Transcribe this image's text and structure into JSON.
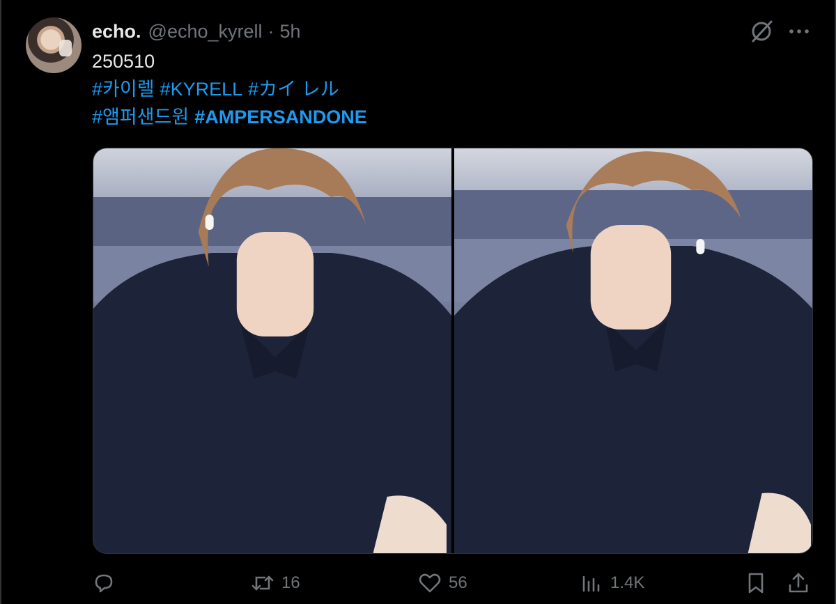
{
  "tweet": {
    "display_name": "echo.",
    "handle": "@echo_kyrell",
    "separator": "·",
    "time": "5h",
    "text_line1": "250510",
    "hashtags_line2": [
      "#카이렐",
      "#KYRELL",
      "#カイ レル"
    ],
    "hashtags_line3": [
      "#앰퍼샌드원",
      "#AMPERSANDONE"
    ]
  },
  "media": {
    "count": 2
  },
  "actions": {
    "replies": "",
    "retweets": "16",
    "likes": "56",
    "views": "1.4K"
  },
  "icons": {
    "header": [
      "grok-icon",
      "more-icon"
    ],
    "actions": [
      "reply-icon",
      "retweet-icon",
      "like-icon",
      "views-icon",
      "bookmark-icon",
      "share-icon"
    ]
  },
  "colors": {
    "background": "#000000",
    "text": "#e7e9ea",
    "muted": "#71767b",
    "link": "#1d9bf0",
    "border": "#2f3336"
  }
}
